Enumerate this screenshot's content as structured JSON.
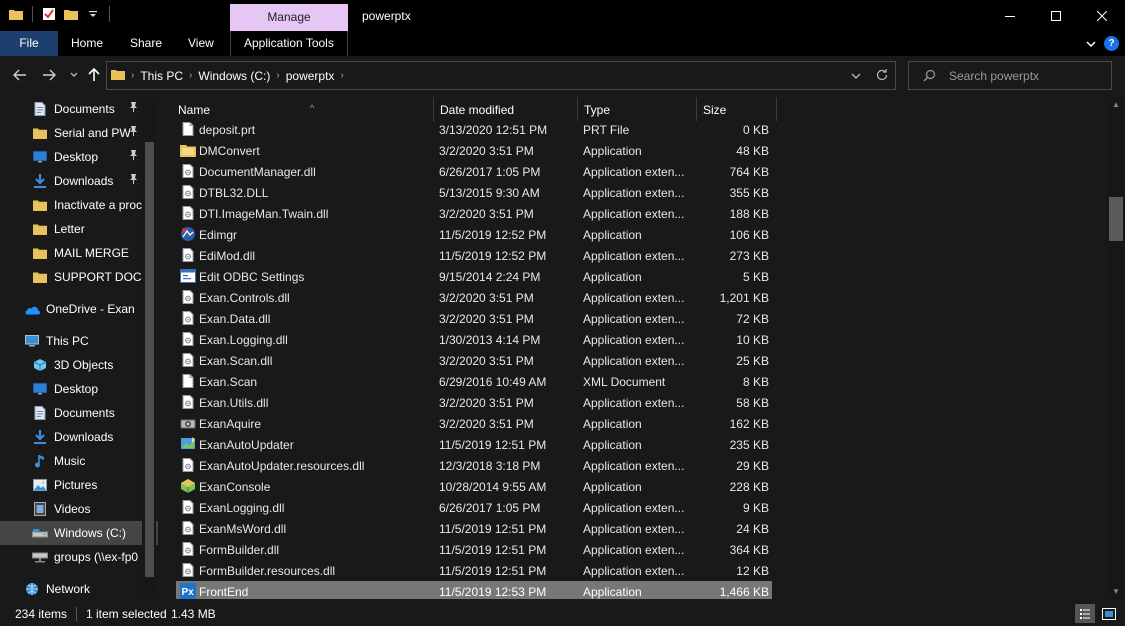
{
  "window": {
    "title": "powerptx",
    "contextual_tab": "Manage"
  },
  "ribbon": {
    "tabs": [
      "File",
      "Home",
      "Share",
      "View",
      "Application Tools"
    ]
  },
  "address": {
    "crumbs": [
      "This PC",
      "Windows (C:)",
      "powerptx"
    ]
  },
  "search": {
    "placeholder": "Search powerptx"
  },
  "nav": {
    "items": [
      {
        "label": "Documents",
        "icon": "documents-icon",
        "pinned": true
      },
      {
        "label": "Serial and PW",
        "icon": "folder-icon",
        "pinned": true
      },
      {
        "label": "Desktop",
        "icon": "desktop-icon",
        "pinned": true
      },
      {
        "label": "Downloads",
        "icon": "downloads-icon",
        "pinned": true
      },
      {
        "label": "Inactivate a proc",
        "icon": "folder-icon",
        "pinned": false
      },
      {
        "label": "Letter",
        "icon": "folder-icon",
        "pinned": false
      },
      {
        "label": "MAIL MERGE",
        "icon": "folder-icon",
        "pinned": false
      },
      {
        "label": "SUPPORT DOCU",
        "icon": "folder-icon",
        "pinned": false
      },
      {
        "label": "OneDrive - Exan",
        "icon": "onedrive-icon",
        "pinned": false
      },
      {
        "label": "This PC",
        "icon": "this-pc-icon",
        "pinned": false
      },
      {
        "label": "3D Objects",
        "icon": "3d-objects-icon",
        "pinned": false
      },
      {
        "label": "Desktop",
        "icon": "desktop-icon",
        "pinned": false
      },
      {
        "label": "Documents",
        "icon": "documents-icon",
        "pinned": false
      },
      {
        "label": "Downloads",
        "icon": "downloads-icon",
        "pinned": false
      },
      {
        "label": "Music",
        "icon": "music-icon",
        "pinned": false
      },
      {
        "label": "Pictures",
        "icon": "pictures-icon",
        "pinned": false
      },
      {
        "label": "Videos",
        "icon": "videos-icon",
        "pinned": false
      },
      {
        "label": "Windows (C:)",
        "icon": "drive-icon",
        "pinned": false,
        "selected": true
      },
      {
        "label": "groups (\\\\ex-fp0",
        "icon": "network-drive-icon",
        "pinned": false
      },
      {
        "label": "Network",
        "icon": "network-icon",
        "pinned": false
      }
    ]
  },
  "columns": {
    "name": "Name",
    "date": "Date modified",
    "type": "Type",
    "size": "Size"
  },
  "files": [
    {
      "name": "deposit.prt",
      "date": "3/13/2020 12:51 PM",
      "type": "PRT File",
      "size": "0 KB",
      "icon": "file-icon"
    },
    {
      "name": "DMConvert",
      "date": "3/2/2020 3:51 PM",
      "type": "Application",
      "size": "48 KB",
      "icon": "folder-app-icon"
    },
    {
      "name": "DocumentManager.dll",
      "date": "6/26/2017 1:05 PM",
      "type": "Application exten...",
      "size": "764 KB",
      "icon": "dll-icon"
    },
    {
      "name": "DTBL32.DLL",
      "date": "5/13/2015 9:30 AM",
      "type": "Application exten...",
      "size": "355 KB",
      "icon": "dll-icon"
    },
    {
      "name": "DTI.ImageMan.Twain.dll",
      "date": "3/2/2020 3:51 PM",
      "type": "Application exten...",
      "size": "188 KB",
      "icon": "dll-icon"
    },
    {
      "name": "Edimgr",
      "date": "11/5/2019 12:52 PM",
      "type": "Application",
      "size": "106 KB",
      "icon": "edimgr-app-icon"
    },
    {
      "name": "EdiMod.dll",
      "date": "11/5/2019 12:52 PM",
      "type": "Application exten...",
      "size": "273 KB",
      "icon": "dll-icon"
    },
    {
      "name": "Edit ODBC Settings",
      "date": "9/15/2014 2:24 PM",
      "type": "Application",
      "size": "5 KB",
      "icon": "window-app-icon"
    },
    {
      "name": "Exan.Controls.dll",
      "date": "3/2/2020 3:51 PM",
      "type": "Application exten...",
      "size": "1,201 KB",
      "icon": "dll-icon"
    },
    {
      "name": "Exan.Data.dll",
      "date": "3/2/2020 3:51 PM",
      "type": "Application exten...",
      "size": "72 KB",
      "icon": "dll-icon"
    },
    {
      "name": "Exan.Logging.dll",
      "date": "1/30/2013 4:14 PM",
      "type": "Application exten...",
      "size": "10 KB",
      "icon": "dll-icon"
    },
    {
      "name": "Exan.Scan.dll",
      "date": "3/2/2020 3:51 PM",
      "type": "Application exten...",
      "size": "25 KB",
      "icon": "dll-icon"
    },
    {
      "name": "Exan.Scan",
      "date": "6/29/2016 10:49 AM",
      "type": "XML Document",
      "size": "8 KB",
      "icon": "file-icon"
    },
    {
      "name": "Exan.Utils.dll",
      "date": "3/2/2020 3:51 PM",
      "type": "Application exten...",
      "size": "58 KB",
      "icon": "dll-icon"
    },
    {
      "name": "ExanAquire",
      "date": "3/2/2020 3:51 PM",
      "type": "Application",
      "size": "162 KB",
      "icon": "scanner-app-icon"
    },
    {
      "name": "ExanAutoUpdater",
      "date": "11/5/2019 12:51 PM",
      "type": "Application",
      "size": "235 KB",
      "icon": "updater-app-icon"
    },
    {
      "name": "ExanAutoUpdater.resources.dll",
      "date": "12/3/2018 3:18 PM",
      "type": "Application exten...",
      "size": "29 KB",
      "icon": "dll-icon"
    },
    {
      "name": "ExanConsole",
      "date": "10/28/2014 9:55 AM",
      "type": "Application",
      "size": "228 KB",
      "icon": "console-app-icon"
    },
    {
      "name": "ExanLogging.dll",
      "date": "6/26/2017 1:05 PM",
      "type": "Application exten...",
      "size": "9 KB",
      "icon": "dll-icon"
    },
    {
      "name": "ExanMsWord.dll",
      "date": "11/5/2019 12:51 PM",
      "type": "Application exten...",
      "size": "24 KB",
      "icon": "dll-icon"
    },
    {
      "name": "FormBuilder.dll",
      "date": "11/5/2019 12:51 PM",
      "type": "Application exten...",
      "size": "364 KB",
      "icon": "dll-icon"
    },
    {
      "name": "FormBuilder.resources.dll",
      "date": "11/5/2019 12:51 PM",
      "type": "Application exten...",
      "size": "12 KB",
      "icon": "dll-icon"
    },
    {
      "name": "FrontEnd",
      "date": "11/5/2019 12:53 PM",
      "type": "Application",
      "size": "1,466 KB",
      "icon": "px-app-icon",
      "selected": true
    }
  ],
  "status": {
    "count": "234 items",
    "selection": "1 item selected",
    "selection_size": "1.43 MB"
  },
  "colors": {
    "background": "#191919",
    "manage_tab": "#e6c6f4",
    "file_tab": "#1c3f6e",
    "selected_row": "#777777",
    "folder_yellow": "#e8c15a",
    "accent_blue": "#1a73e8"
  }
}
